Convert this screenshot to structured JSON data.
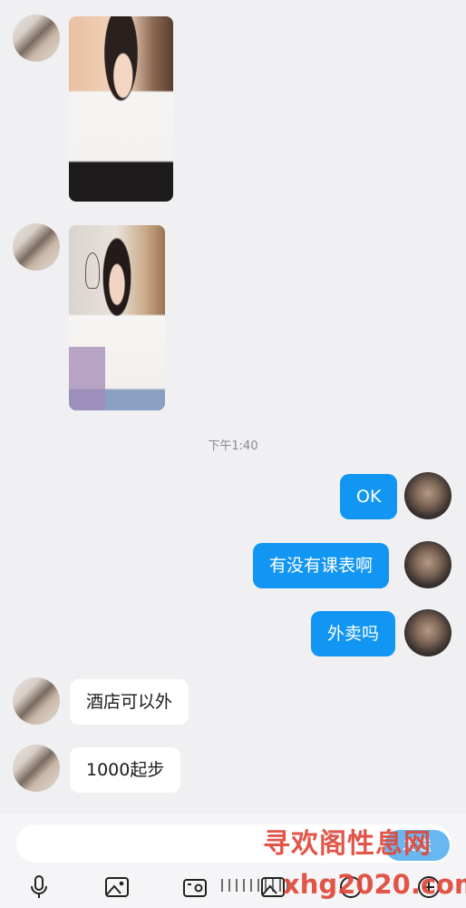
{
  "chat": {
    "timestamp": "下午1:40",
    "messages_out": [
      {
        "text": "OK"
      },
      {
        "text": "有没有课表啊"
      },
      {
        "text": "外卖吗"
      }
    ],
    "messages_in": [
      {
        "text": "酒店可以外"
      },
      {
        "text": "1000起步"
      }
    ]
  },
  "input_bar": {
    "send_label": "发送"
  },
  "watermark": {
    "line1": "寻欢阁性息网",
    "line2": "xhg2020.com"
  },
  "colors": {
    "outgoing_bubble": "#1296f3",
    "incoming_bubble": "#ffffff",
    "background": "#f0f0f2"
  },
  "icons": [
    "microphone-icon",
    "image-icon",
    "camera-icon",
    "gallery-icon",
    "emoji-icon",
    "plus-icon"
  ]
}
